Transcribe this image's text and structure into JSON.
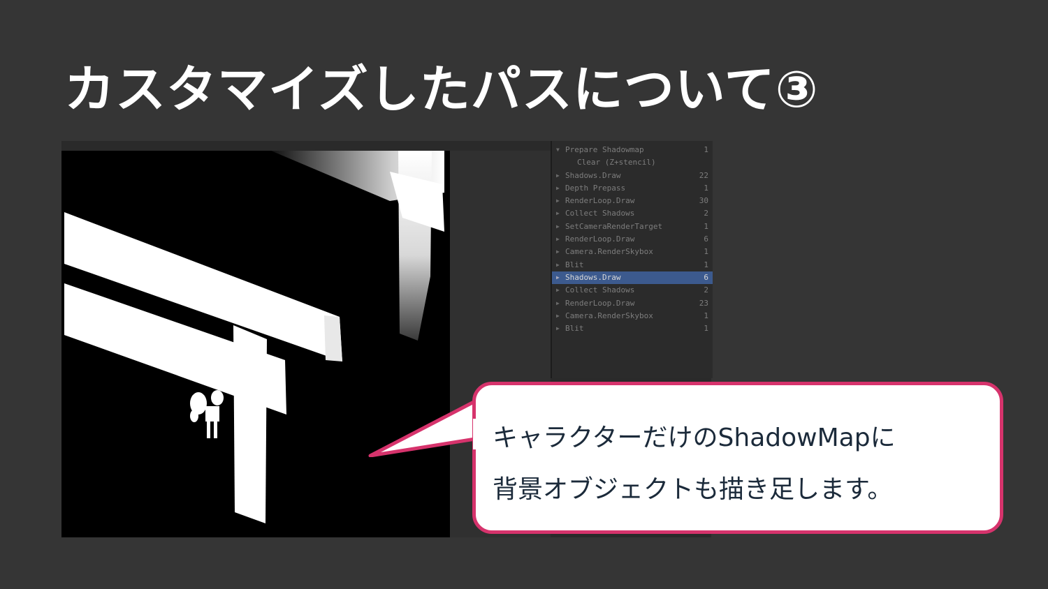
{
  "slide": {
    "title": "カスタマイズしたパスについて③"
  },
  "frame_debugger": {
    "items": [
      {
        "label": "Prepare Shadowmap",
        "count": "1",
        "expanded": true
      },
      {
        "label": "Clear (Z+stencil)",
        "count": "",
        "child": true
      },
      {
        "label": "Shadows.Draw",
        "count": "22"
      },
      {
        "label": "Depth Prepass",
        "count": "1"
      },
      {
        "label": "RenderLoop.Draw",
        "count": "30"
      },
      {
        "label": "Collect Shadows",
        "count": "2"
      },
      {
        "label": "SetCameraRenderTarget",
        "count": "1"
      },
      {
        "label": "RenderLoop.Draw",
        "count": "6"
      },
      {
        "label": "Camera.RenderSkybox",
        "count": "1"
      },
      {
        "label": "Blit",
        "count": "1"
      },
      {
        "label": "Shadows.Draw",
        "count": "6",
        "selected": true
      },
      {
        "label": "Collect Shadows",
        "count": "2"
      },
      {
        "label": "RenderLoop.Draw",
        "count": "23"
      },
      {
        "label": "Camera.RenderSkybox",
        "count": "1"
      },
      {
        "label": "Blit",
        "count": "1"
      }
    ]
  },
  "callout": {
    "line1": "キャラクターだけのShadowMapに",
    "line2": "背景オブジェクトも描き足します。"
  },
  "colors": {
    "background": "#353535",
    "accent": "#d6336c",
    "selected_row": "#3c5a8e"
  }
}
